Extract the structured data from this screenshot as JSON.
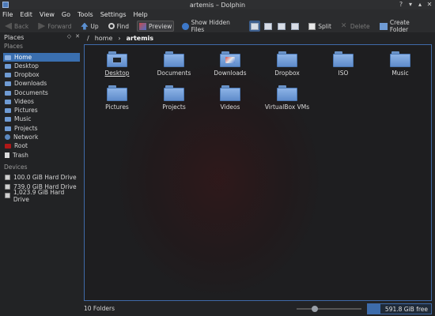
{
  "window": {
    "title": "artemis – Dolphin"
  },
  "menu": [
    "File",
    "Edit",
    "View",
    "Go",
    "Tools",
    "Settings",
    "Help"
  ],
  "toolbar": {
    "back": "Back",
    "forward": "Forward",
    "up": "Up",
    "find": "Find",
    "preview": "Preview",
    "show_hidden": "Show Hidden Files",
    "split": "Split",
    "delete": "Delete",
    "create_folder": "Create Folder"
  },
  "places": {
    "title": "Places",
    "section": "Places",
    "items": [
      {
        "label": "Home",
        "icon": "home-icon"
      },
      {
        "label": "Desktop",
        "icon": "folder-icon"
      },
      {
        "label": "Dropbox",
        "icon": "folder-icon"
      },
      {
        "label": "Downloads",
        "icon": "folder-icon"
      },
      {
        "label": "Documents",
        "icon": "folder-icon"
      },
      {
        "label": "Videos",
        "icon": "folder-icon"
      },
      {
        "label": "Pictures",
        "icon": "folder-icon"
      },
      {
        "label": "Music",
        "icon": "folder-icon"
      },
      {
        "label": "Projects",
        "icon": "folder-icon"
      },
      {
        "label": "Network",
        "icon": "network-icon"
      },
      {
        "label": "Root",
        "icon": "root-folder-icon"
      },
      {
        "label": "Trash",
        "icon": "trash-icon"
      }
    ]
  },
  "devices": {
    "section": "Devices",
    "items": [
      {
        "label": "100.0 GiB Hard Drive",
        "icon": "hard-drive-icon"
      },
      {
        "label": "739.0 GiB Hard Drive",
        "icon": "hard-drive-icon"
      },
      {
        "label": "1,023.9 GiB Hard Drive",
        "icon": "hard-drive-icon"
      }
    ]
  },
  "breadcrumb": {
    "root": "/",
    "parent": "home",
    "current": "artemis"
  },
  "files": [
    {
      "name": "Desktop",
      "badge": "desktop"
    },
    {
      "name": "Documents",
      "badge": ""
    },
    {
      "name": "Downloads",
      "badge": "downloads"
    },
    {
      "name": "Dropbox",
      "badge": ""
    },
    {
      "name": "ISO",
      "badge": ""
    },
    {
      "name": "Music",
      "badge": ""
    },
    {
      "name": "Pictures",
      "badge": ""
    },
    {
      "name": "Projects",
      "badge": ""
    },
    {
      "name": "Videos",
      "badge": ""
    },
    {
      "name": "VirtualBox VMs",
      "badge": ""
    }
  ],
  "status": {
    "text": "10 Folders",
    "free_space": "591.8 GiB free",
    "zoom_fraction": 0.25,
    "used_fraction": 0.2
  },
  "colors": {
    "accent": "#3a6fb0",
    "root_icon": "#b01818"
  }
}
